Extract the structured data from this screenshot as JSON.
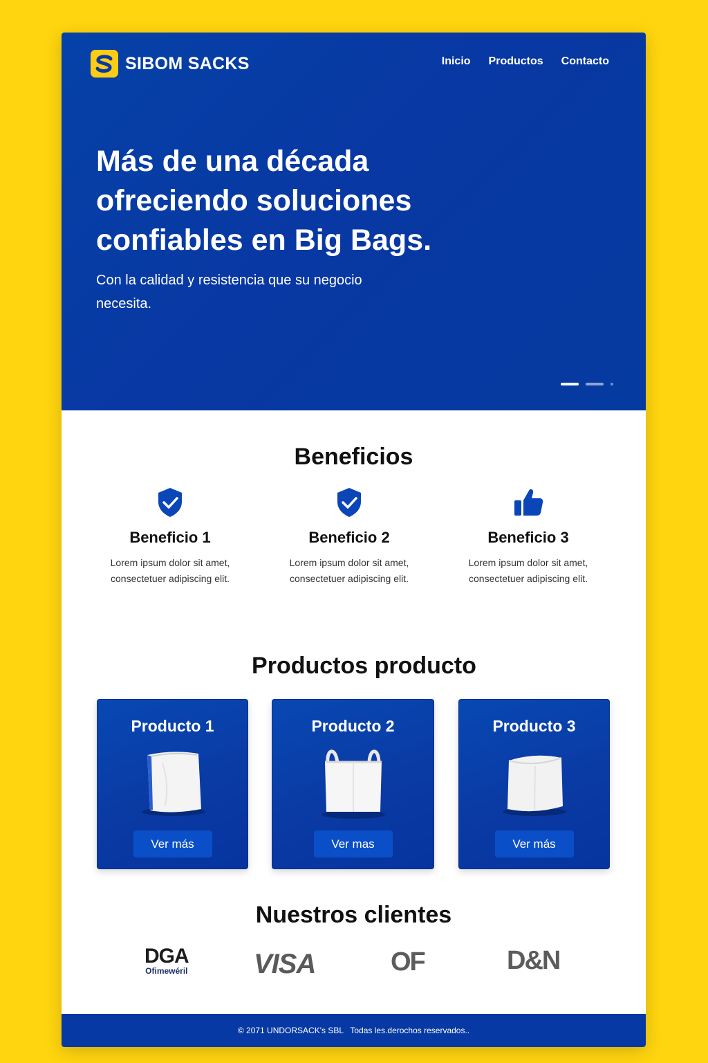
{
  "brand": {
    "name": "SIBOM SACKS",
    "logo_letter": "S",
    "color": "#0639A3",
    "accent": "#FFCC14"
  },
  "nav": [
    "Inicio",
    "Productos",
    "Contacto"
  ],
  "hero": {
    "title": "Más de una década ofreciendo soluciones confiables en Big Bags.",
    "subtitle": "Con la calidad y resistencia que su negocio necesita.",
    "slides": 3,
    "active_slide": 1
  },
  "benefits": {
    "title": "Beneficios",
    "items": [
      {
        "icon": "shield-check-icon",
        "title": "Beneficio 1",
        "text": "Lorem ipsum dolor sit amet, consectetuer adipiscing elit."
      },
      {
        "icon": "shield-check-icon",
        "title": "Beneficio 2",
        "text": "Lorem ipsum dolor sit amet, consectetuer adipiscing elit."
      },
      {
        "icon": "thumbs-up-icon",
        "title": "Beneficio 3",
        "text": "Lorem ipsum dolor sit amet, consectetuer adipiscing elit."
      }
    ]
  },
  "products": {
    "title": "Productos producto",
    "items": [
      {
        "title": "Producto 1",
        "button": "Ver más"
      },
      {
        "title": "Producto 2",
        "button": "Ver mas"
      },
      {
        "title": "Producto 3",
        "button": "Ver más"
      }
    ]
  },
  "clients": {
    "title": "Nuestros clientes",
    "logos": [
      {
        "main": "DGA",
        "sub": "Ofimewéril"
      },
      {
        "main": "VISA"
      },
      {
        "main": "OF"
      },
      {
        "main": "D&N"
      }
    ]
  },
  "footer": {
    "text": "© 2071 UNDORSACK's SBL   Todas les.derochos reservados.."
  }
}
